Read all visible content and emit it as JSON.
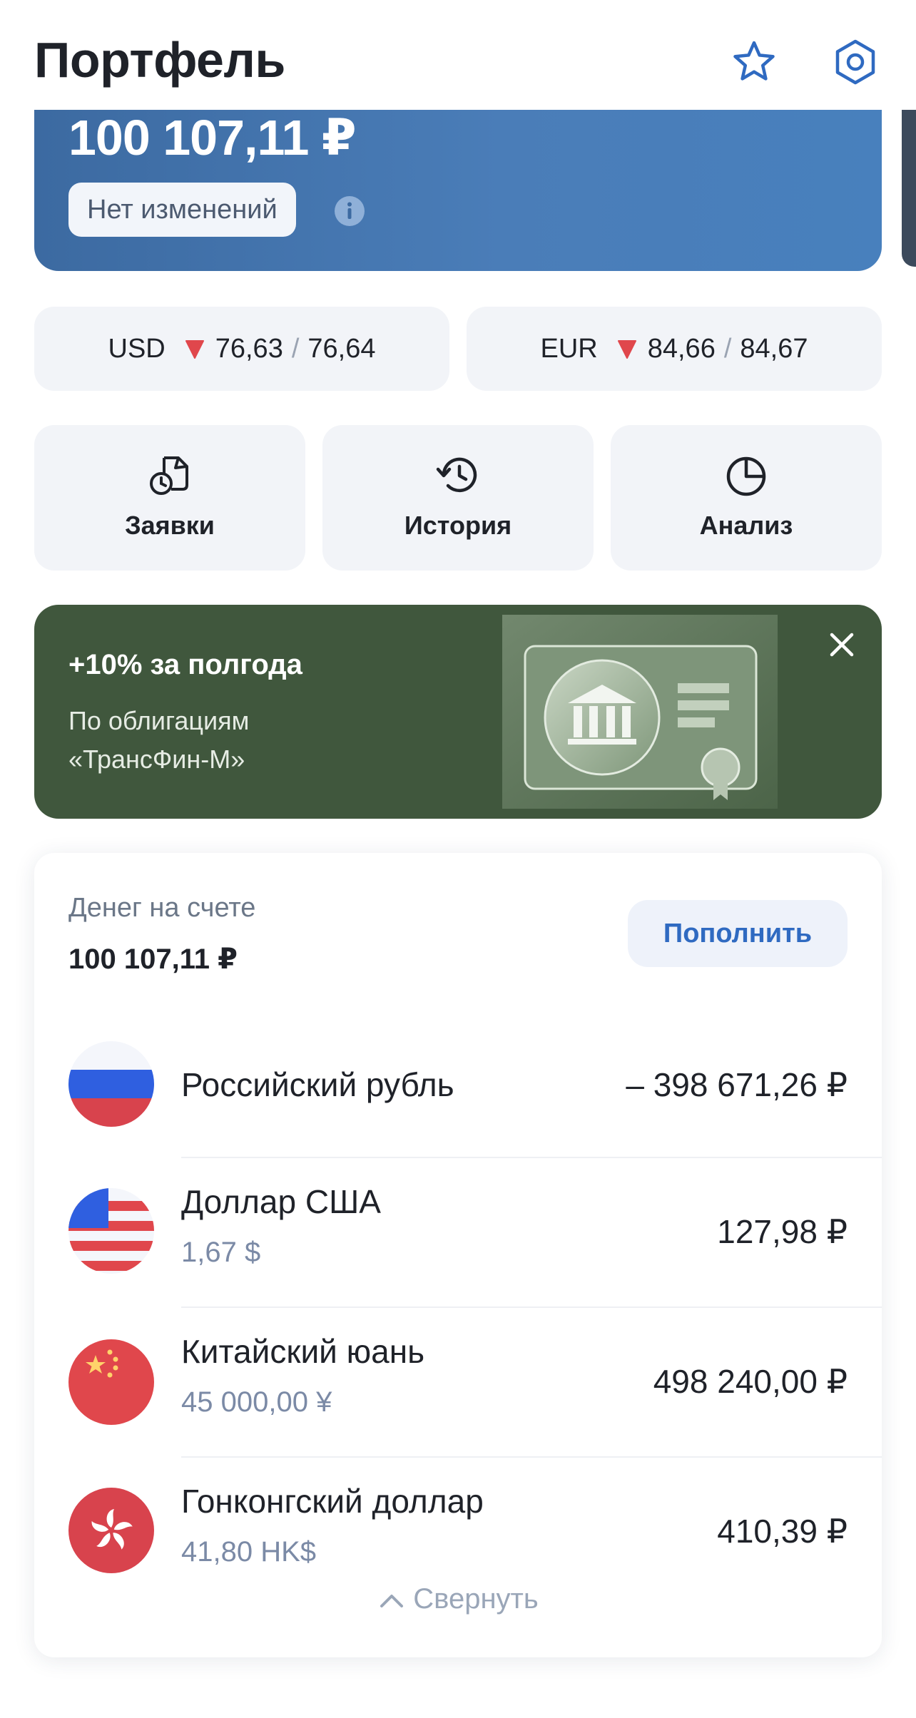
{
  "header": {
    "title": "Портфель",
    "favorite_icon": "star-icon",
    "settings_icon": "gear-icon"
  },
  "balance": {
    "amount": "100 107,11 ₽",
    "change_badge": "Нет изменений",
    "info_icon": "info-icon"
  },
  "rates": [
    {
      "code": "USD",
      "trend": "down",
      "buy": "76,63",
      "separator": "/",
      "sell": "76,64"
    },
    {
      "code": "EUR",
      "trend": "down",
      "buy": "84,66",
      "separator": "/",
      "sell": "84,67"
    }
  ],
  "quick_actions": [
    {
      "label": "Заявки",
      "icon": "orders-icon"
    },
    {
      "label": "История",
      "icon": "history-icon"
    },
    {
      "label": "Анализ",
      "icon": "analytics-pie-icon"
    }
  ],
  "promo": {
    "title": "+10% за полгода",
    "subtitle": "По облигациям «ТрансФин-М»",
    "close_icon": "close-icon",
    "background": "#40573d"
  },
  "money": {
    "label": "Денег на счете",
    "amount": "100 107,11 ₽",
    "topup_label": "Пополнить",
    "currencies": [
      {
        "name": "Российский рубль",
        "sub": "",
        "value": "– 398 671,26 ₽",
        "flag": "russia-flag-icon"
      },
      {
        "name": "Доллар США",
        "sub": "1,67 $",
        "value": "127,98 ₽",
        "flag": "usa-flag-icon"
      },
      {
        "name": "Китайский юань",
        "sub": "45 000,00 ¥",
        "value": "498 240,00 ₽",
        "flag": "china-flag-icon"
      },
      {
        "name": "Гонконгский доллар",
        "sub": "41,80 HK$",
        "value": "410,39 ₽",
        "flag": "hongkong-flag-icon"
      }
    ],
    "collapse_label": "Свернуть"
  },
  "colors": {
    "accent": "#2f6ac1",
    "down": "#e0474c",
    "card_blue": "#4a7db8",
    "promo_green": "#40573d"
  }
}
